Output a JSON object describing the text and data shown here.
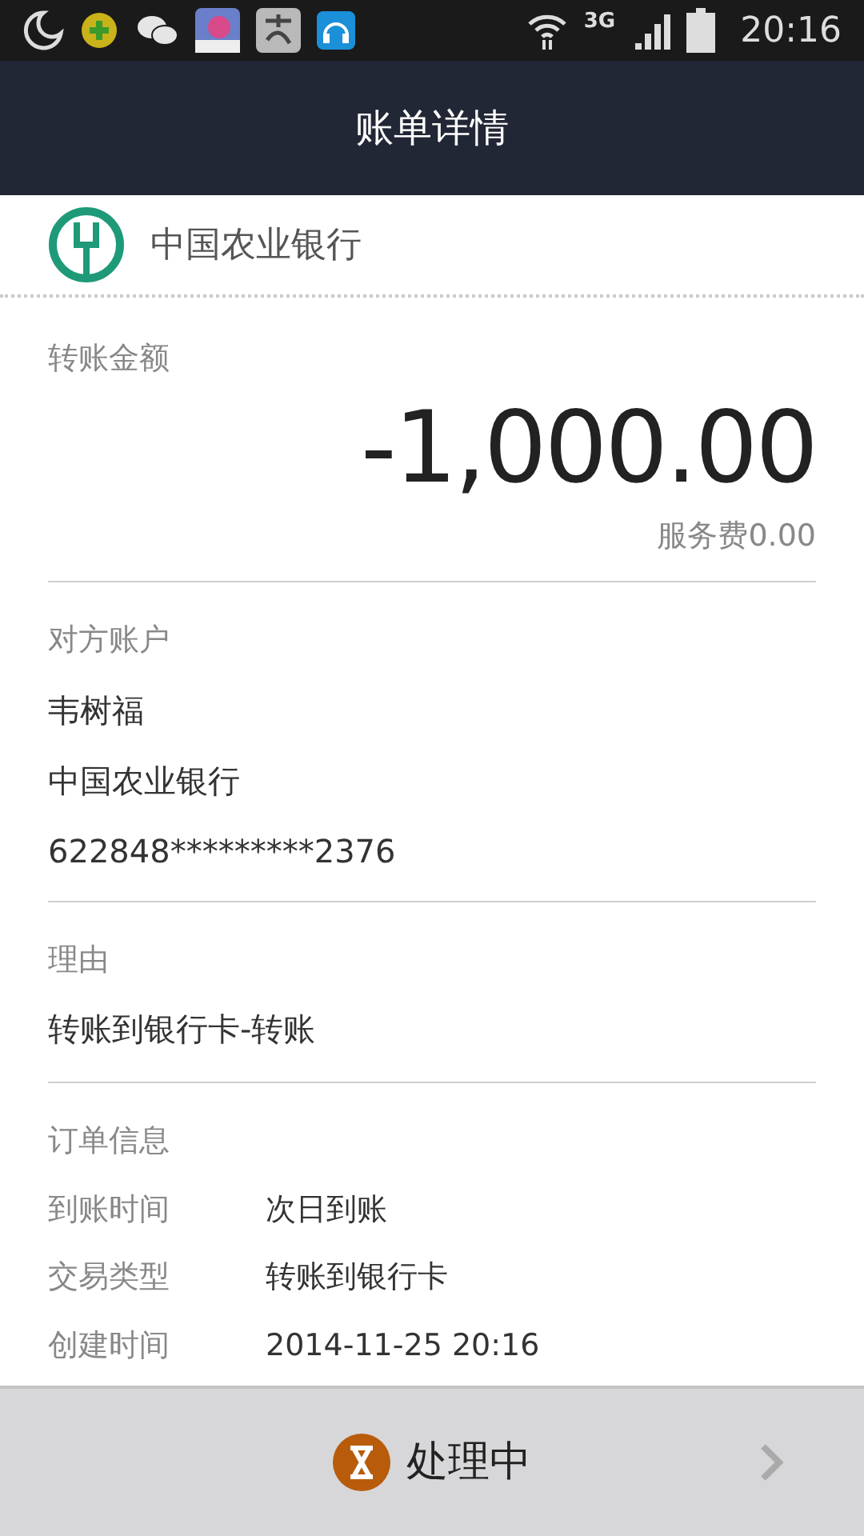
{
  "status_bar": {
    "time": "20:16",
    "network": "3G"
  },
  "header": {
    "title": "账单详情"
  },
  "bank": {
    "name": "中国农业银行"
  },
  "amount_section": {
    "label": "转账金额",
    "amount": "-1,000.00",
    "fee": "服务费0.00"
  },
  "counterparty": {
    "label": "对方账户",
    "name": "韦树福",
    "bank": "中国农业银行",
    "account": "622848*********2376"
  },
  "reason": {
    "label": "理由",
    "text": "转账到银行卡-转账"
  },
  "order_info": {
    "label": "订单信息",
    "rows": [
      {
        "key": "到账时间",
        "value": "次日到账"
      },
      {
        "key": "交易类型",
        "value": "转账到银行卡"
      },
      {
        "key": "创建时间",
        "value": "2014-11-25 20:16"
      }
    ]
  },
  "status_button": {
    "label": "处理中"
  }
}
